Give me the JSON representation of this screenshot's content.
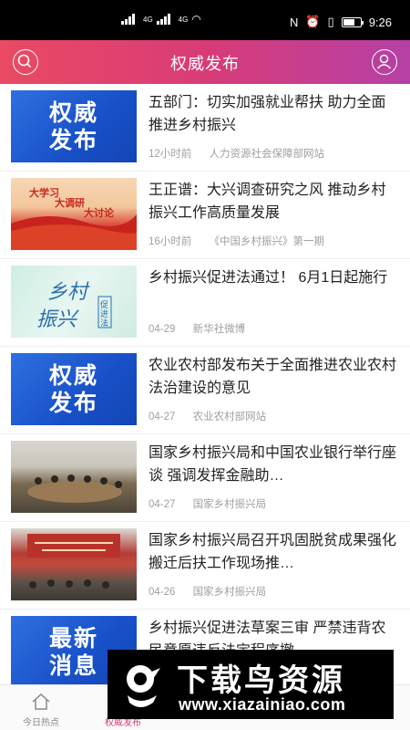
{
  "status_bar": {
    "net1": "4G",
    "net2": "4G",
    "time": "9:26"
  },
  "header": {
    "title": "权威发布",
    "left_icon": "search-icon",
    "right_icon": "user-icon",
    "gradient_colors": [
      "#ea4a63",
      "#d83c77",
      "#b540a6"
    ]
  },
  "news": [
    {
      "thumb_text": "权威\n发布",
      "title": "五部门：切实加强就业帮扶 助力全面推进乡村振兴",
      "time": "12小时前",
      "source": "人力资源社会保障部网站"
    },
    {
      "thumb_text": "",
      "title": "王正谱：大兴调查研究之风 推动乡村振兴工作高质量发展",
      "time": "16小时前",
      "source": "《中国乡村振兴》第一期"
    },
    {
      "thumb_text": "",
      "title": "乡村振兴促进法通过！ 6月1日起施行",
      "time": "04-29",
      "source": "新华社微博"
    },
    {
      "thumb_text": "权威\n发布",
      "title": "农业农村部发布关于全面推进农业农村法治建设的意见",
      "time": "04-27",
      "source": "农业农村部网站"
    },
    {
      "thumb_text": "",
      "title": "国家乡村振兴局和中国农业银行举行座谈 强调发挥金融助…",
      "time": "04-27",
      "source": "国家乡村振兴局"
    },
    {
      "thumb_text": "",
      "title": "国家乡村振兴局召开巩固脱贫成果强化搬迁后扶工作现场推…",
      "time": "04-26",
      "source": "国家乡村振兴局"
    },
    {
      "thumb_text": "最新\n消息",
      "title": "乡村振兴促进法草案三审 严禁违背农民意愿违反法定程序撤…",
      "time": "",
      "source": ""
    }
  ],
  "bottom_nav": [
    {
      "label": "今日热点",
      "icon": "home-icon",
      "active": false
    },
    {
      "label": "权威发布",
      "icon": "publish-icon",
      "active": true
    },
    {
      "label": "",
      "icon": "",
      "active": false
    },
    {
      "label": "",
      "icon": "",
      "active": false
    },
    {
      "label": "",
      "icon": "",
      "active": false
    }
  ],
  "watermark": {
    "brand": "下载鸟资源",
    "url": "www.xiazainiao.com"
  }
}
